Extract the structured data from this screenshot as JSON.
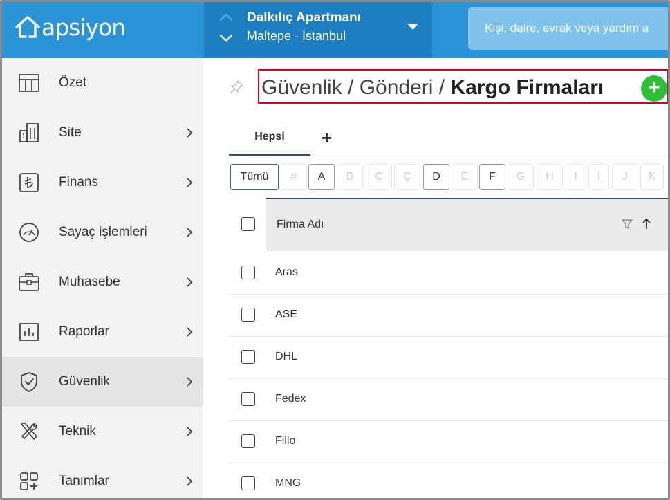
{
  "brand": {
    "logo_text": "apsiyon"
  },
  "site": {
    "name": "Dalkılıç Apartmanı",
    "location": "Maltepe - İstanbul"
  },
  "search": {
    "placeholder": "Kişi, daire, evrak veya yardım a"
  },
  "sidebar": {
    "items": [
      {
        "label": "Özet",
        "icon": "grid-table-icon",
        "has_arrow": false
      },
      {
        "label": "Site",
        "icon": "buildings-icon",
        "has_arrow": true
      },
      {
        "label": "Finans",
        "icon": "lira-icon",
        "has_arrow": true
      },
      {
        "label": "Sayaç işlemleri",
        "icon": "gauge-icon",
        "has_arrow": true
      },
      {
        "label": "Muhasebe",
        "icon": "briefcase-icon",
        "has_arrow": true
      },
      {
        "label": "Raporlar",
        "icon": "bar-report-icon",
        "has_arrow": true
      },
      {
        "label": "Güvenlik",
        "icon": "shield-icon",
        "has_arrow": true,
        "active": true
      },
      {
        "label": "Teknik",
        "icon": "tools-icon",
        "has_arrow": true
      },
      {
        "label": "Tanımlar",
        "icon": "apps-plus-icon",
        "has_arrow": true
      }
    ]
  },
  "page": {
    "breadcrumb_prefix": "Güvenlik / Gönderi / ",
    "breadcrumb_current": "Kargo Firmaları",
    "add_symbol": "+"
  },
  "tabs": {
    "items": [
      "Hepsi"
    ],
    "add_symbol": "+"
  },
  "letter_filter": {
    "items": [
      {
        "label": "Tümü",
        "state": "all"
      },
      {
        "label": "#",
        "state": "disabled"
      },
      {
        "label": "A",
        "state": "enabled"
      },
      {
        "label": "B",
        "state": "disabled"
      },
      {
        "label": "C",
        "state": "disabled"
      },
      {
        "label": "Ç",
        "state": "disabled"
      },
      {
        "label": "D",
        "state": "enabled"
      },
      {
        "label": "E",
        "state": "disabled"
      },
      {
        "label": "F",
        "state": "enabled"
      },
      {
        "label": "G",
        "state": "disabled"
      },
      {
        "label": "H",
        "state": "disabled"
      },
      {
        "label": "I",
        "state": "disabled"
      },
      {
        "label": "İ",
        "state": "disabled"
      },
      {
        "label": "J",
        "state": "disabled"
      },
      {
        "label": "K",
        "state": "disabled"
      }
    ]
  },
  "table": {
    "column_header": "Firma Adı",
    "rows": [
      "Aras",
      "ASE",
      "DHL",
      "Fedex",
      "Fillo",
      "MNG"
    ]
  },
  "colors": {
    "topbar": "#2a94d6",
    "site_switch": "#1e7ec2",
    "highlight_border": "#e0001b",
    "add_button": "#2fbe35"
  }
}
